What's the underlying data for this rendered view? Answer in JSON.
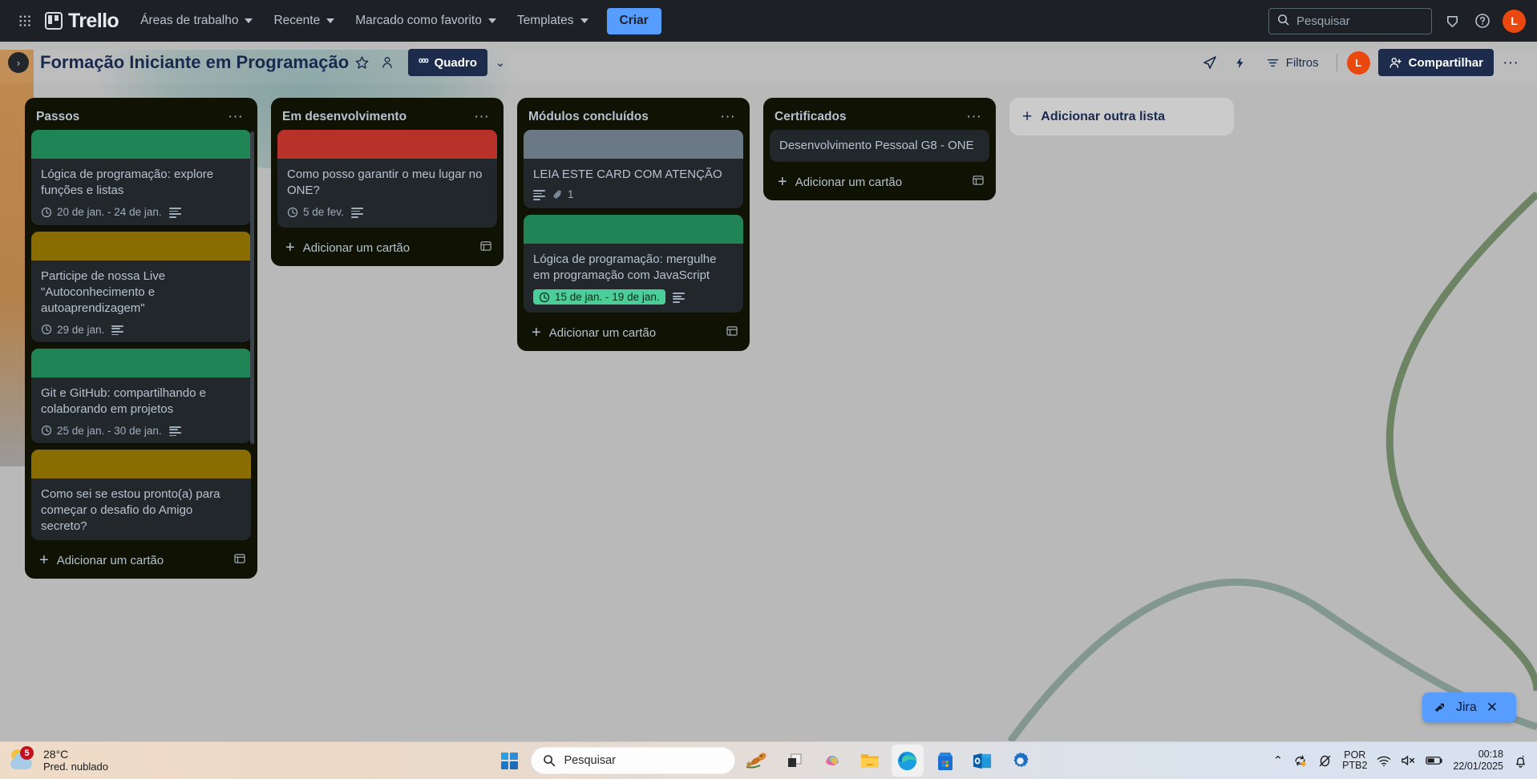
{
  "topnav": {
    "apps_icon": "grid-apps-icon",
    "brand": "Trello",
    "items": [
      {
        "label": "Áreas de trabalho",
        "has_chevron": true
      },
      {
        "label": "Recente",
        "has_chevron": true
      },
      {
        "label": "Marcado como favorito",
        "has_chevron": true
      },
      {
        "label": "Templates",
        "has_chevron": true
      }
    ],
    "create_label": "Criar",
    "search_placeholder": "Pesquisar",
    "search_value": "",
    "notifications_icon": "bell-icon",
    "help_icon": "help-circle-icon",
    "avatar_initial": "L"
  },
  "boardbar": {
    "sidebar_toggle": "›",
    "title": "Formação Iniciante em Programação",
    "star_icon": "star-icon",
    "visibility_icon": "workspace-visible-icon",
    "view_label": "Quadro",
    "view_glyph": "⁰⁰⁰",
    "view_chevron": "⌄",
    "rocket_icon": "rocket-icon",
    "automation_icon": "lightning-icon",
    "filters_label": "Filtros",
    "member_initial": "L",
    "share_label": "Compartilhar",
    "more_label": "···"
  },
  "board": {
    "add_list_label": "Adicionar outra lista",
    "add_card_label": "Adicionar um cartão",
    "lists": [
      {
        "title": "Passos",
        "cards": [
          {
            "title": "Lógica de programação: explore funções e listas",
            "cover_color": "#1f8456",
            "date": "20 de jan. - 24 de jan.",
            "date_done": false,
            "has_description": true,
            "attachments": null
          },
          {
            "title": "Participe de nossa Live \"Autoconhecimento e autoaprendizagem\"",
            "cover_color": "#8a6d00",
            "date": "29 de jan.",
            "date_done": false,
            "has_description": true,
            "attachments": null
          },
          {
            "title": "Git e GitHub: compartilhando e colaborando em projetos",
            "cover_color": "#1f8456",
            "date": "25 de jan. - 30 de jan.",
            "date_done": false,
            "has_description": true,
            "attachments": null
          },
          {
            "title": "Como sei se estou pronto(a) para começar o desafio do Amigo secreto?",
            "cover_color": "#8a6d00",
            "date": null,
            "date_done": false,
            "has_description": false,
            "attachments": null
          }
        ]
      },
      {
        "title": "Em desenvolvimento",
        "cards": [
          {
            "title": "Como posso garantir o meu lugar no ONE?",
            "cover_color": "#b9322a",
            "date": "5 de fev.",
            "date_done": false,
            "has_description": true,
            "attachments": null
          }
        ]
      },
      {
        "title": "Módulos concluídos",
        "cards": [
          {
            "title": "LEIA ESTE CARD COM ATENÇÃO",
            "cover_color": "#6b7886",
            "date": null,
            "date_done": false,
            "has_description": true,
            "attachments": "1"
          },
          {
            "title": "Lógica de programação: mergulhe em programação com JavaScript",
            "cover_color": "#1f8456",
            "date": "15 de jan. - 19 de jan.",
            "date_done": true,
            "has_description": true,
            "attachments": null
          }
        ]
      },
      {
        "title": "Certificados",
        "cards": [
          {
            "title": "Desenvolvimento Pessoal G8 - ONE",
            "cover_color": null,
            "date": null,
            "date_done": false,
            "has_description": false,
            "attachments": null
          }
        ]
      }
    ]
  },
  "jira_widget": {
    "label": "Jira",
    "icon": "jira-icon",
    "close_label": "✕"
  },
  "taskbar": {
    "weather_temp": "28°C",
    "weather_desc": "Pred. nublado",
    "weather_badge": "5",
    "start_icon": "windows-start-icon",
    "search_placeholder": "Pesquisar",
    "apps": [
      {
        "name": "squirrel-widget-icon"
      },
      {
        "name": "task-view-icon"
      },
      {
        "name": "copilot-icon"
      },
      {
        "name": "file-explorer-icon"
      },
      {
        "name": "microsoft-edge-icon"
      },
      {
        "name": "microsoft-store-icon"
      },
      {
        "name": "outlook-icon"
      },
      {
        "name": "settings-icon"
      }
    ],
    "tray_chevron": "⌃",
    "tray_sync_icon": "onedrive-sync-icon",
    "tray_mouse_icon": "mouse-disabled-icon",
    "lang_line1": "POR",
    "lang_line2": "PTB2",
    "wifi_icon": "wifi-icon",
    "volume_icon": "volume-muted-icon",
    "battery_icon": "battery-icon",
    "time": "00:18",
    "date": "22/01/2025",
    "notify_icon": "notifications-dnd-icon"
  },
  "colors": {
    "accent": "#579dff",
    "list_bg": "#101204",
    "card_bg": "#22272b",
    "nav_bg": "#1d2125",
    "text": "#b6c2cf"
  }
}
